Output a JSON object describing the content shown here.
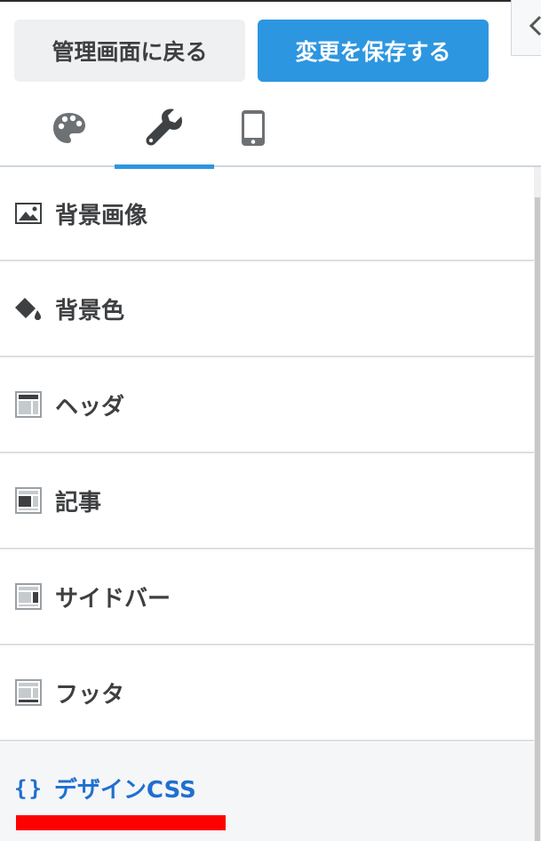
{
  "header": {
    "back_label": "管理画面に戻る",
    "save_label": "変更を保存する"
  },
  "tabs": [
    {
      "icon": "palette-icon",
      "active": false
    },
    {
      "icon": "wrench-icon",
      "active": true
    },
    {
      "icon": "mobile-icon",
      "active": false
    }
  ],
  "menu": {
    "items": [
      {
        "label": "背景画像",
        "icon": "image-icon"
      },
      {
        "label": "背景色",
        "icon": "paint-bucket-icon"
      },
      {
        "label": "ヘッダ",
        "icon": "layout-header-icon"
      },
      {
        "label": "記事",
        "icon": "layout-article-icon"
      },
      {
        "label": "サイドバー",
        "icon": "layout-sidebar-icon"
      },
      {
        "label": "フッタ",
        "icon": "layout-footer-icon"
      }
    ],
    "design_css": {
      "braces": "{}",
      "label": "デザインCSS"
    }
  },
  "colors": {
    "accent": "#2d96e0",
    "link": "#1f6fd0",
    "highlight": "#ff0000",
    "text": "#3d3f41"
  }
}
